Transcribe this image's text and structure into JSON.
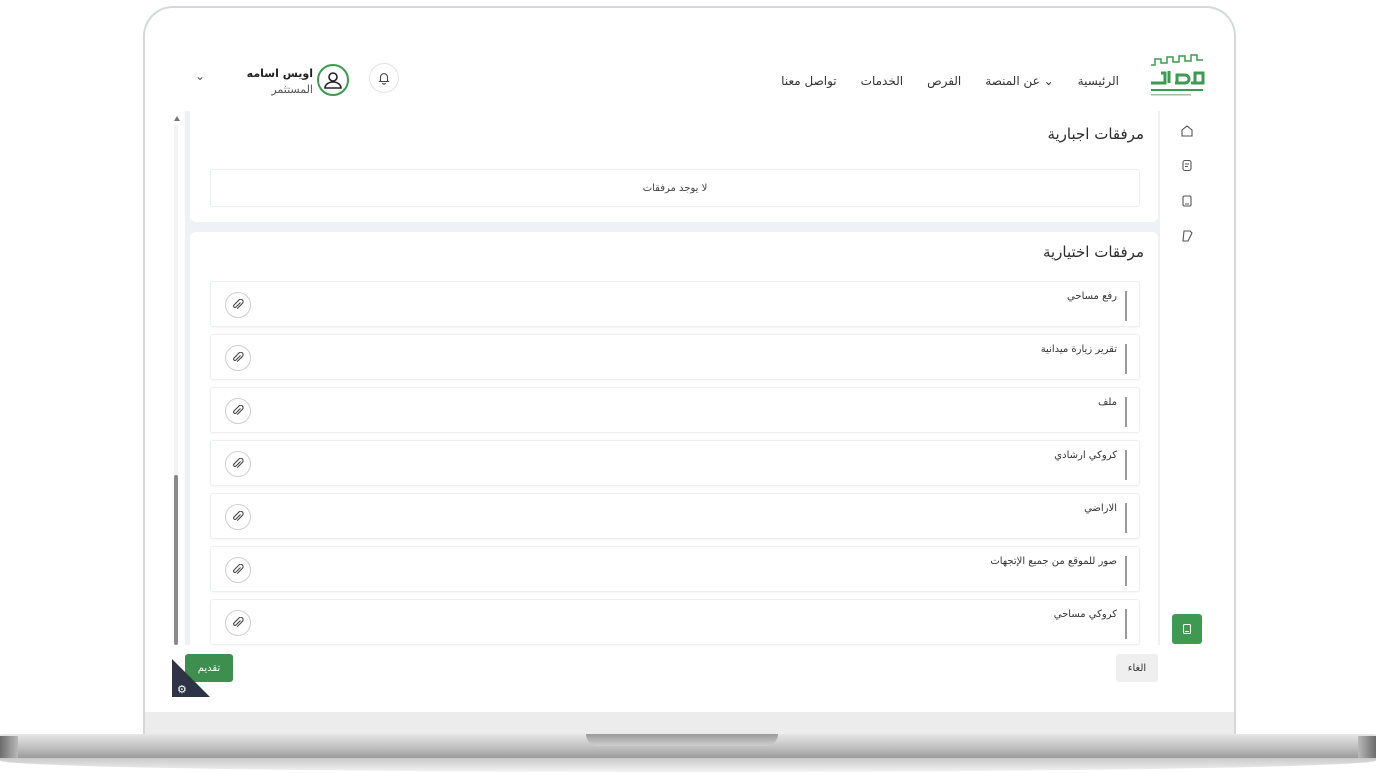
{
  "header": {
    "nav": [
      "الرئيسية",
      "عن المنصة",
      "الفرص",
      "الخدمات",
      "تواصل معنا"
    ],
    "user_name": "اويس اسامه",
    "user_role": "المستثمر"
  },
  "mandatory": {
    "title": "مرفقات اجبارية",
    "empty_text": "لا يوجد مرفقات"
  },
  "optional": {
    "title": "مرفقات اختيارية",
    "items": [
      "رفع مساحي",
      "تقرير زيارة ميدانية",
      "ملف",
      "كروكي ارشادي",
      "الاراضي",
      "صور للموقع من جميع الإتجهات",
      "كروكي مساحي"
    ]
  },
  "footer": {
    "cancel_label": "الغاء",
    "submit_label": "تقديم"
  },
  "colors": {
    "brand_green": "#3e9a51",
    "content_bg": "#eef2f6"
  },
  "icons": [
    "home-icon",
    "clipboard-icon",
    "document-icon",
    "tag-icon",
    "book-icon",
    "bell-icon",
    "user-icon",
    "paperclip-icon",
    "gear-icon"
  ]
}
